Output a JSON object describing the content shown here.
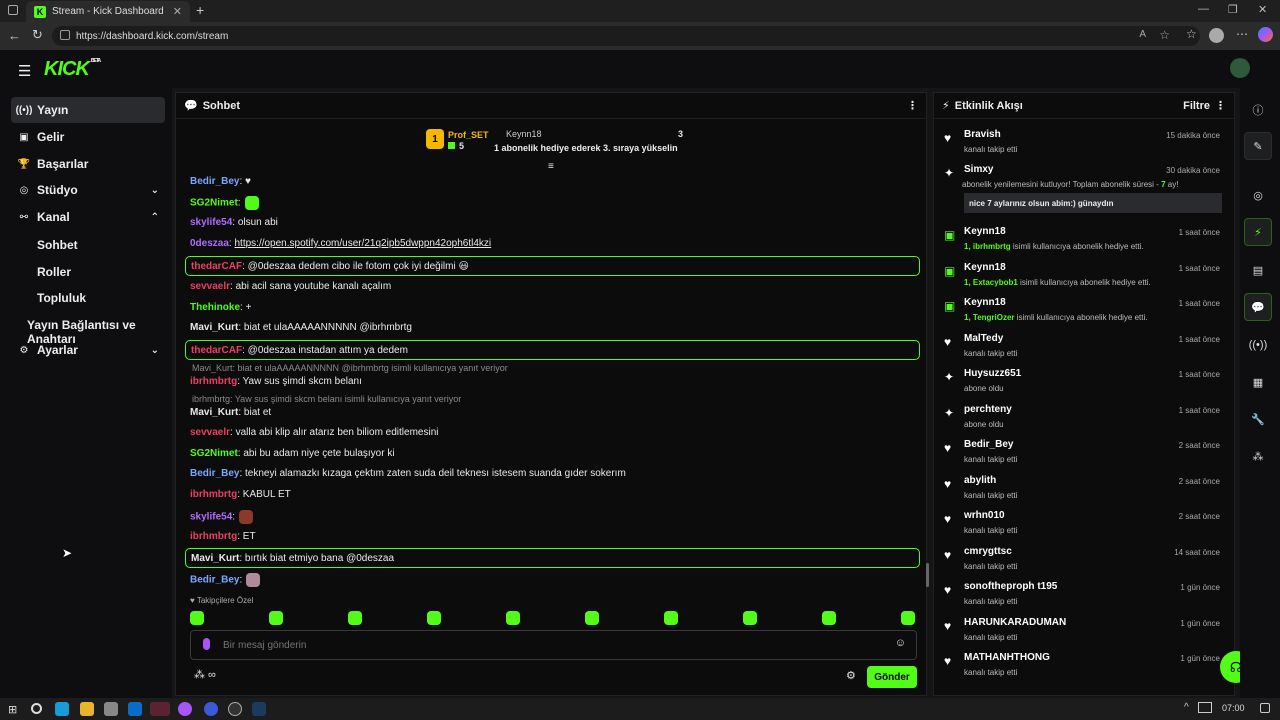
{
  "browser": {
    "tab_title": "Stream - Kick Dashboard",
    "url": "https://dashboard.kick.com/stream",
    "new_tab": "+",
    "time": "07:00"
  },
  "brand": {
    "logo": "KICK",
    "beta": "BETA",
    "accent": "#53fc18"
  },
  "sidebar": {
    "items": [
      {
        "label": "Yayın",
        "icon": "broadcast-icon"
      },
      {
        "label": "Gelir",
        "icon": "wallet-icon"
      },
      {
        "label": "Başarılar",
        "icon": "trophy-icon"
      },
      {
        "label": "Stüdyo",
        "icon": "studio-icon"
      },
      {
        "label": "Kanal",
        "icon": "channel-icon"
      },
      {
        "label": "Ayarlar",
        "icon": "gear-icon"
      }
    ],
    "subitems": [
      "Sohbet",
      "Roller",
      "Topluluk",
      "Yayın Bağlantısı ve Anahtarı"
    ]
  },
  "chat": {
    "title": "Sohbet",
    "top": {
      "rank": "1",
      "user1": "Prof_SET",
      "user1_count": "5",
      "user2": "Keynn18",
      "user2_count": "3",
      "promo": "1 abonelik hediye ederek 3. sıraya yükselin"
    },
    "messages": [
      {
        "user": "Bedir_Bey",
        "text": ": ♥",
        "color": "#7aa7ff"
      },
      {
        "user": "SG2Nimet",
        "text": ":",
        "color": "#53fc18"
      },
      {
        "user": "skylife54",
        "text": ": olsun abi",
        "color": "#b36bff"
      },
      {
        "user": "0deszaa",
        "text": ": ",
        "link": "https://open.spotify.com/user/21q2ipb5dwppn42oph6tl4kzi",
        "color": "#b36bff"
      },
      {
        "user": "thedarCAF",
        "text": ": @0deszaa dedem cibo ile fotom çok iyi değilmi 😃",
        "color": "#e8425e"
      },
      {
        "user": "sevvaelr",
        "text": ": abi acil sana youtube kanalı açalım",
        "color": "#e8425e"
      },
      {
        "user": "Thehinoke",
        "text": ": +",
        "color": "#53fc18"
      },
      {
        "user": "Mavi_Kurt",
        "text": ": biat et ulaAAAAANNNNN @ibrhmbrtg",
        "color": "#e8e8e8"
      },
      {
        "user": "thedarCAF",
        "text": ": @0deszaa instadan attım ya dedem",
        "color": "#e8425e"
      },
      {
        "reply": "Mavi_Kurt: biat et ulaAAAAANNNNN @ibrhmbrtg isimli kullanıcıya yanıt veriyor"
      },
      {
        "user": "ibrhmbrtg",
        "text": ": Yaw sus şimdi skcm belanı",
        "color": "#e8425e"
      },
      {
        "reply": "ibrhmbrtg: Yaw sus şimdi skcm belanı isimli kullanıcıya yanıt veriyor"
      },
      {
        "user": "Mavi_Kurt",
        "text": ": biat et",
        "color": "#e8e8e8"
      },
      {
        "user": "sevvaelr",
        "text": ": valla abi klip alır atarız ben biliom editlemesini",
        "color": "#e8425e"
      },
      {
        "user": "SG2Nimet",
        "text": ": abi bu adam niye çete bulaşıyor ki",
        "color": "#53fc18"
      },
      {
        "user": "Bedir_Bey",
        "text": ": tekneyi alamazkı kızaga çektım zaten suda deil teknesı istesem suanda gıder sokerım",
        "color": "#7aa7ff"
      },
      {
        "user": "ibrhmbrtg",
        "text": ": KABUL ET",
        "color": "#e8425e"
      },
      {
        "user": "skylife54",
        "text": ":",
        "color": "#b36bff"
      },
      {
        "user": "ibrhmbrtg",
        "text": ": ET",
        "color": "#e8425e"
      },
      {
        "user": "Mavi_Kurt",
        "text": ": bırtık biat etmiyo bana @0deszaa",
        "color": "#e8e8e8"
      },
      {
        "user": "Bedir_Bey",
        "text": ":",
        "color": "#7aa7ff"
      }
    ],
    "follower_note": "Takipçilere Özel",
    "input_placeholder": "Bir mesaj gönderin",
    "send_label": "Gönder"
  },
  "activity": {
    "title": "Etkinlik Akışı",
    "filter": "Filtre",
    "items": [
      {
        "icon": "heart-icon",
        "name": "Bravish",
        "desc": "kanalı takip etti",
        "time": "15 dakika önce"
      },
      {
        "icon": "subscribe-icon",
        "name": "Simxy",
        "desc": "abonelik yenilemesini kutluyor! Toplam abonelik süresi - ",
        "months": "7",
        "desc_tail": " ay!",
        "time": "30 dakika önce",
        "quote": "nice 7 aylarınız olsun abim:) günaydın"
      },
      {
        "icon": "gift-icon",
        "name": "Keynn18",
        "count": "1, ibrhmbrtg",
        "desc": " isimli kullanıcıya abonelik hediye etti.",
        "time": "1 saat önce"
      },
      {
        "icon": "gift-icon",
        "name": "Keynn18",
        "count": "1, Extacybob1",
        "desc": " isimli kullanıcıya abonelik hediye etti.",
        "time": "1 saat önce"
      },
      {
        "icon": "gift-icon",
        "name": "Keynn18",
        "count": "1, TengriOzer",
        "desc": " isimli kullanıcıya abonelik hediye etti.",
        "time": "1 saat önce"
      },
      {
        "icon": "heart-icon",
        "name": "MalTedy",
        "desc": "kanalı takip etti",
        "time": "1 saat önce"
      },
      {
        "icon": "sparkle-icon",
        "name": "Huysuzz651",
        "desc": "abone oldu",
        "time": "1 saat önce"
      },
      {
        "icon": "sparkle-icon",
        "name": "perchteny",
        "desc": "abone oldu",
        "time": "1 saat önce"
      },
      {
        "icon": "heart-icon",
        "name": "Bedir_Bey",
        "desc": "kanalı takip etti",
        "time": "2 saat önce"
      },
      {
        "icon": "heart-icon",
        "name": "abylith",
        "desc": "kanalı takip etti",
        "time": "2 saat önce"
      },
      {
        "icon": "heart-icon",
        "name": "wrhn010",
        "desc": "kanalı takip etti",
        "time": "2 saat önce"
      },
      {
        "icon": "heart-icon",
        "name": "cmrygttsc",
        "desc": "kanalı takip etti",
        "time": "14 saat önce"
      },
      {
        "icon": "heart-icon",
        "name": "sonoftheproph t195",
        "desc": "kanalı takip etti",
        "time": "1 gün önce"
      },
      {
        "icon": "heart-icon",
        "name": "HARUNKARADUMAN",
        "desc": "kanalı takip etti",
        "time": "1 gün önce"
      },
      {
        "icon": "heart-icon",
        "name": "MATHANHTHONG",
        "desc": "kanalı takip etti",
        "time": "1 gün önce"
      }
    ]
  }
}
